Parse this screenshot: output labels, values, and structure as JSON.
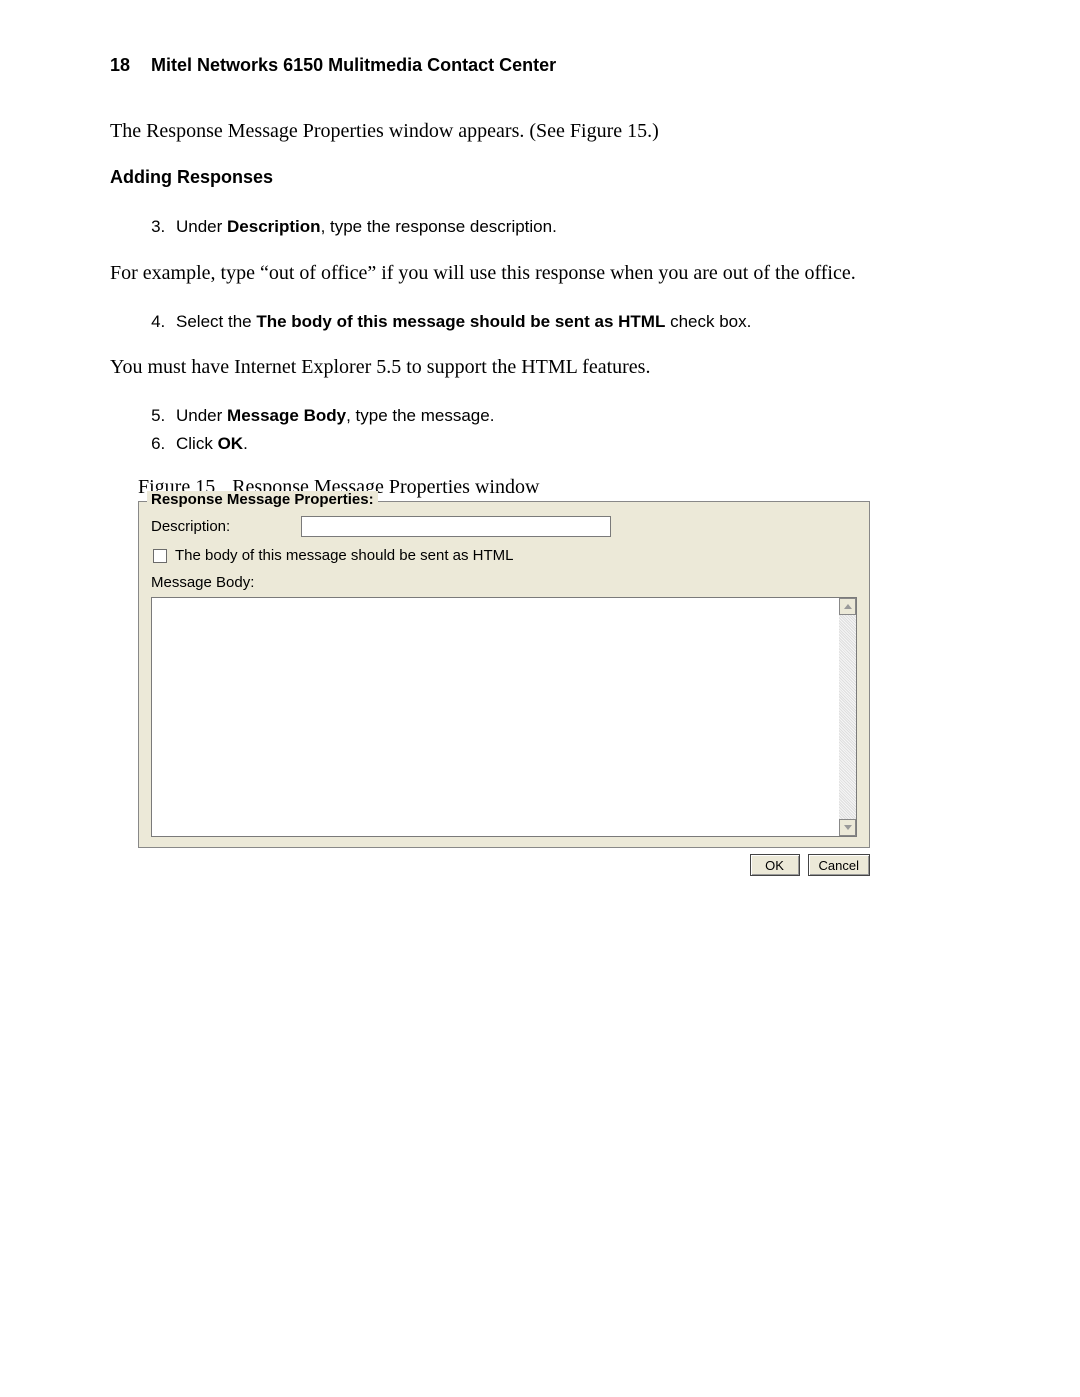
{
  "header": {
    "page_number": "18",
    "title": "Mitel Networks 6150 Mulitmedia Contact Center"
  },
  "intro_paragraph": "The Response Message Properties window appears. (See Figure 15.)",
  "subheading": "Adding Responses",
  "step3": {
    "prefix": "Under ",
    "bold": "Description",
    "suffix": ", type the response description."
  },
  "para_after_3": "For example, type “out of office” if you will use this response when you are out of the office.",
  "step4": {
    "prefix": "Select the ",
    "bold": "The body of this message should be sent as HTML",
    "suffix": " check box."
  },
  "para_after_4": "You must have Internet Explorer 5.5 to support the HTML features.",
  "step5": {
    "prefix": "Under ",
    "bold": "Message Body",
    "suffix": ", type the message."
  },
  "step6": {
    "prefix": "Click ",
    "bold": "OK",
    "suffix": "."
  },
  "figure": {
    "number": "Figure 15",
    "title": "Response Message Properties window"
  },
  "panel": {
    "group_title": "Response Message Properties:",
    "description_label": "Description:",
    "description_value": "",
    "html_checkbox_label": "The body of this message should be sent as HTML",
    "message_body_label": "Message Body:",
    "message_body_value": "",
    "ok_label": "OK",
    "cancel_label": "Cancel"
  }
}
